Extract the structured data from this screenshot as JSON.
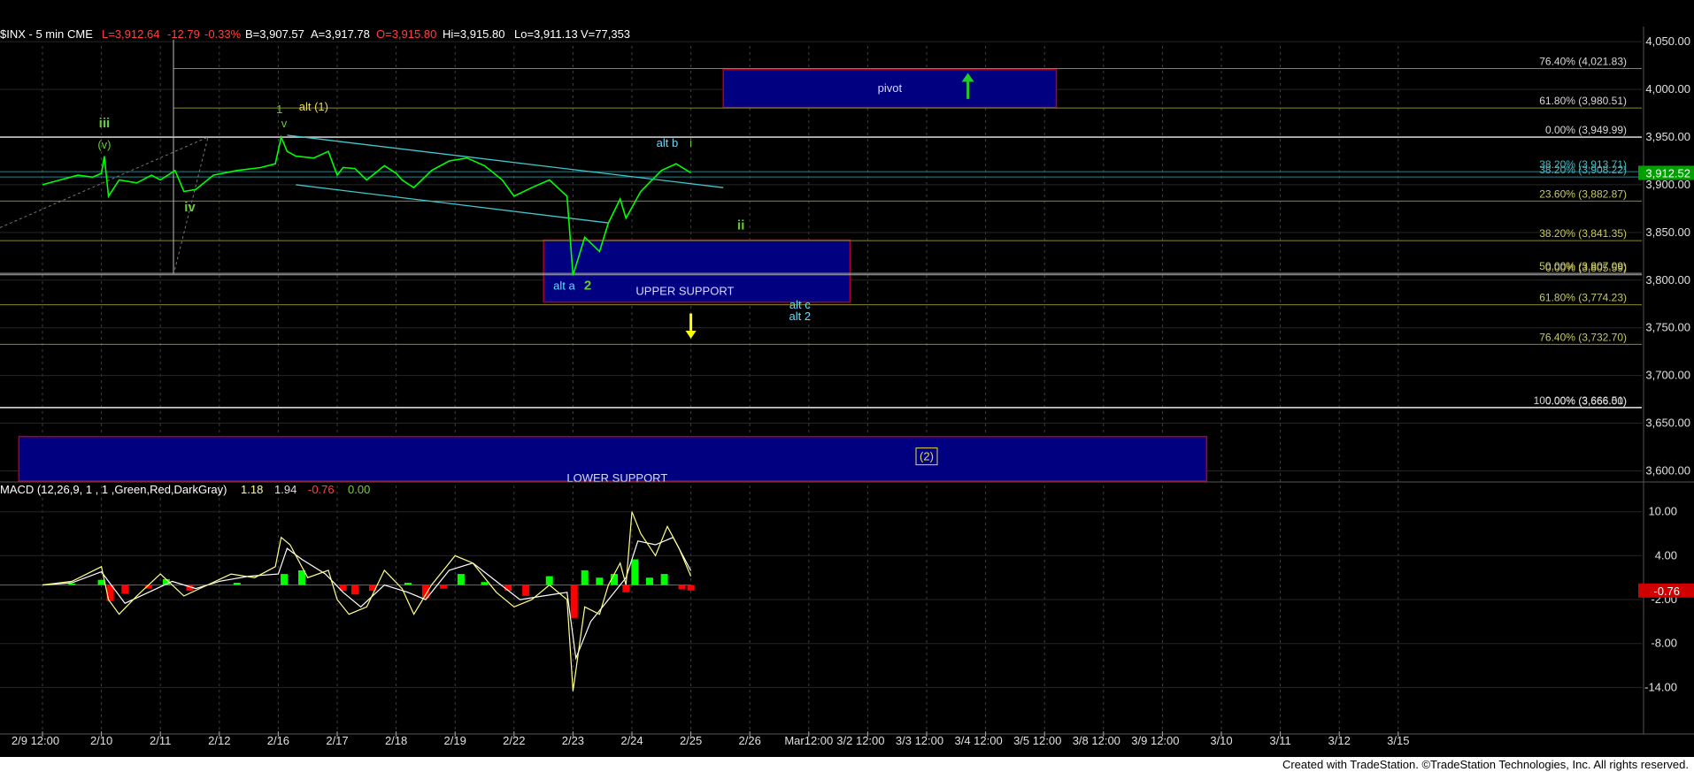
{
  "header": {
    "symbol": "$INX - 5 min",
    "exchange": "CME",
    "last": "L=3,912.64",
    "change": "-12.79",
    "change_pct": "-0.33%",
    "bid": "B=3,907.57",
    "ask": "A=3,917.78",
    "open": "O=3,915.80",
    "high": "Hi=3,915.80",
    "low": "Lo=3,911.13",
    "volume": "V=77,353"
  },
  "footer": {
    "credit": "Created with TradeStation. ©TradeStation Technologies, Inc. All rights reserved."
  },
  "colors": {
    "background": "#000000",
    "price_line": "#00ff00",
    "support_zone": "#000080",
    "zone_border": "#b00020",
    "channel": "#40c8d0",
    "fib_level": "#8a8a2a",
    "wave_green": "#66cc33",
    "wave_yellow": "#e8d85a",
    "wave_cyan": "#66d9ff",
    "arrow_green": "#22cc22",
    "arrow_yellow": "#ffff00",
    "macd_line": "#ffff88",
    "signal_line": "#ffffff",
    "hist_up": "#00ff00",
    "hist_down": "#ff0000"
  },
  "chart_data": [
    {
      "type": "line",
      "name": "price",
      "x_ticks": [
        "2/9 12:00",
        "2/10",
        "2/11",
        "2/12",
        "2/16",
        "2/17",
        "2/18",
        "2/19",
        "2/22",
        "2/23",
        "2/24",
        "2/25",
        "2/26",
        "Mar12:00",
        "3/2 12:00",
        "3/3 12:00",
        "3/4 12:00",
        "3/5 12:00",
        "3/8 12:00",
        "3/9 12:00",
        "3/10",
        "3/11",
        "3/12",
        "3/15"
      ],
      "y_ticks": [
        "4,050.00",
        "4,000.00",
        "3,950.00",
        "3,900.00",
        "3,850.00",
        "3,800.00",
        "3,750.00",
        "3,700.00",
        "3,650.00",
        "3,600.00"
      ],
      "ylim": [
        3585,
        4052
      ],
      "last_price_label": "3,912.52",
      "last_price": 3912.52,
      "series_points": [
        [
          0,
          3900
        ],
        [
          0.3,
          3905
        ],
        [
          0.6,
          3910
        ],
        [
          0.85,
          3908
        ],
        [
          1.0,
          3912
        ],
        [
          1.05,
          3930
        ],
        [
          1.12,
          3888
        ],
        [
          1.3,
          3905
        ],
        [
          1.6,
          3902
        ],
        [
          1.85,
          3910
        ],
        [
          2.0,
          3905
        ],
        [
          2.25,
          3915
        ],
        [
          2.4,
          3893
        ],
        [
          2.6,
          3895
        ],
        [
          2.9,
          3910
        ],
        [
          3.3,
          3915
        ],
        [
          3.7,
          3918
        ],
        [
          3.95,
          3922
        ],
        [
          4.05,
          3950
        ],
        [
          4.15,
          3935
        ],
        [
          4.3,
          3930
        ],
        [
          4.6,
          3928
        ],
        [
          4.85,
          3935
        ],
        [
          5.0,
          3910
        ],
        [
          5.1,
          3918
        ],
        [
          5.3,
          3917
        ],
        [
          5.5,
          3905
        ],
        [
          5.8,
          3920
        ],
        [
          6.0,
          3912
        ],
        [
          6.1,
          3905
        ],
        [
          6.3,
          3897
        ],
        [
          6.6,
          3915
        ],
        [
          6.9,
          3925
        ],
        [
          7.2,
          3928
        ],
        [
          7.5,
          3920
        ],
        [
          7.8,
          3905
        ],
        [
          8.0,
          3888
        ],
        [
          8.3,
          3897
        ],
        [
          8.6,
          3905
        ],
        [
          8.9,
          3888
        ],
        [
          9.0,
          3805
        ],
        [
          9.2,
          3845
        ],
        [
          9.45,
          3830
        ],
        [
          9.6,
          3860
        ],
        [
          9.8,
          3885
        ],
        [
          9.9,
          3865
        ],
        [
          10.15,
          3893
        ],
        [
          10.5,
          3915
        ],
        [
          10.75,
          3922
        ],
        [
          11.0,
          3912.5
        ]
      ],
      "fib_levels": [
        {
          "label": "76.40% (4,021.83)",
          "value": 4021.83
        },
        {
          "label": "61.80% (3,980.51)",
          "value": 3980.51
        },
        {
          "label": "0.00% (3,949.99)",
          "value": 3949.99
        },
        {
          "label": "38.20% (3,913.71)",
          "value": 3913.71
        },
        {
          "label": "38.20% (3,908.22)",
          "value": 3908.22
        },
        {
          "label": "23.60% (3,882.87)",
          "value": 3882.87
        },
        {
          "label": "38.20% (3,841.35)",
          "value": 3841.35
        },
        {
          "label": "50.00% (3,807.09)",
          "value": 3807.09
        },
        {
          "label": "0.00% (3,805.59)",
          "value": 3805.59
        },
        {
          "label": "61.80% (3,774.23)",
          "value": 3774.23
        },
        {
          "label": "76.40% (3,732.70)",
          "value": 3732.7
        },
        {
          "label": "100.00% (3,666.51)",
          "value": 3666.51
        },
        {
          "label": "0.00% (3,666.00)",
          "value": 3666.0
        }
      ],
      "zones": [
        {
          "name": "pivot",
          "label": "pivot",
          "x_from": 11.55,
          "x_to": 17.2,
          "y_from": 3981,
          "y_to": 4021
        },
        {
          "name": "upper-support",
          "label": "UPPER SUPPORT",
          "x_from": 8.5,
          "x_to": 13.7,
          "y_from": 3777,
          "y_to": 3842
        },
        {
          "name": "lower-support",
          "label": "LOWER SUPPORT",
          "x_from": -0.4,
          "x_to": 19.75,
          "y_from": 3585,
          "y_to": 3636
        }
      ],
      "wave_labels": [
        {
          "text": "iii",
          "x": 1.05,
          "y": 3960,
          "color": "green"
        },
        {
          "text": "(v)",
          "x": 1.05,
          "y": 3938,
          "color": "green"
        },
        {
          "text": "iv",
          "x": 2.5,
          "y": 3872,
          "color": "green"
        },
        {
          "text": "1",
          "x": 4.02,
          "y": 3975,
          "color": "green"
        },
        {
          "text": "v",
          "x": 4.1,
          "y": 3960,
          "color": "green"
        },
        {
          "text": "alt (1)",
          "x": 4.6,
          "y": 3978,
          "color": "yellow"
        },
        {
          "text": "alt b",
          "x": 10.6,
          "y": 3940,
          "color": "cyan"
        },
        {
          "text": "i",
          "x": 11.0,
          "y": 3940,
          "color": "green"
        },
        {
          "text": "ii",
          "x": 11.85,
          "y": 3853,
          "color": "green"
        },
        {
          "text": "alt a",
          "x": 8.85,
          "y": 3790,
          "color": "cyan"
        },
        {
          "text": "2",
          "x": 9.25,
          "y": 3790,
          "color": "green"
        },
        {
          "text": "alt c",
          "x": 12.85,
          "y": 3770,
          "color": "cyan"
        },
        {
          "text": "alt 2",
          "x": 12.85,
          "y": 3758,
          "color": "cyan"
        },
        {
          "text": "(2)",
          "x": 15.0,
          "y": 3611,
          "color": "yellow"
        }
      ]
    },
    {
      "type": "line",
      "name": "MACD",
      "indicator_label": "MACD (12,26,9, 1 , 1 ,Green,Red,DarkGray)",
      "values_shown": [
        "1.18",
        "1.94",
        "-0.76",
        "0.00"
      ],
      "last_value": -0.76,
      "last_value_label": "-0.76",
      "y_ticks": [
        "10.00",
        "4.00",
        "-2.00",
        "-8.00",
        "-14.00"
      ],
      "ylim": [
        -15.5,
        12.5
      ],
      "macd_points": [
        [
          0,
          0
        ],
        [
          0.5,
          0.5
        ],
        [
          1.0,
          2.5
        ],
        [
          1.12,
          -2
        ],
        [
          1.3,
          -4
        ],
        [
          1.6,
          -1.5
        ],
        [
          2.0,
          1.5
        ],
        [
          2.4,
          -1.5
        ],
        [
          2.8,
          0
        ],
        [
          3.2,
          1.5
        ],
        [
          3.6,
          1
        ],
        [
          3.95,
          2.5
        ],
        [
          4.05,
          6.5
        ],
        [
          4.2,
          5.5
        ],
        [
          4.5,
          1
        ],
        [
          4.85,
          2
        ],
        [
          5.0,
          -2
        ],
        [
          5.2,
          -4
        ],
        [
          5.5,
          -3
        ],
        [
          5.8,
          2
        ],
        [
          6.1,
          -0.5
        ],
        [
          6.3,
          -4
        ],
        [
          6.6,
          0
        ],
        [
          7.0,
          4
        ],
        [
          7.3,
          3
        ],
        [
          7.7,
          -1
        ],
        [
          8.0,
          -3
        ],
        [
          8.3,
          -2
        ],
        [
          8.6,
          0
        ],
        [
          8.9,
          -2
        ],
        [
          9.0,
          -14.5
        ],
        [
          9.2,
          -3
        ],
        [
          9.45,
          -4
        ],
        [
          9.6,
          0
        ],
        [
          9.8,
          3
        ],
        [
          9.9,
          0
        ],
        [
          10.0,
          10
        ],
        [
          10.15,
          7
        ],
        [
          10.4,
          4
        ],
        [
          10.6,
          8
        ],
        [
          10.8,
          5
        ],
        [
          11.0,
          1.18
        ]
      ],
      "signal_points": [
        [
          0,
          0
        ],
        [
          0.5,
          0.3
        ],
        [
          1.0,
          1.8
        ],
        [
          1.12,
          0.5
        ],
        [
          1.4,
          -2.5
        ],
        [
          1.8,
          -1
        ],
        [
          2.2,
          0.5
        ],
        [
          2.6,
          -0.5
        ],
        [
          3.0,
          0.5
        ],
        [
          3.5,
          1.2
        ],
        [
          4.0,
          1.5
        ],
        [
          4.15,
          5
        ],
        [
          4.4,
          3.5
        ],
        [
          4.8,
          1.5
        ],
        [
          5.1,
          -1
        ],
        [
          5.4,
          -3
        ],
        [
          5.8,
          0
        ],
        [
          6.2,
          -1
        ],
        [
          6.5,
          -2
        ],
        [
          6.9,
          2
        ],
        [
          7.3,
          3
        ],
        [
          7.7,
          0.5
        ],
        [
          8.1,
          -2
        ],
        [
          8.5,
          -1.5
        ],
        [
          8.9,
          -1
        ],
        [
          9.05,
          -10
        ],
        [
          9.3,
          -5
        ],
        [
          9.6,
          -2
        ],
        [
          9.9,
          1
        ],
        [
          10.1,
          6
        ],
        [
          10.4,
          5.5
        ],
        [
          10.7,
          6.5
        ],
        [
          11.0,
          1.94
        ]
      ],
      "histogram_points": [
        [
          0.5,
          0.2
        ],
        [
          1.0,
          0.7
        ],
        [
          1.15,
          -2.2
        ],
        [
          1.4,
          -1.2
        ],
        [
          1.8,
          -0.5
        ],
        [
          2.1,
          0.8
        ],
        [
          2.5,
          -0.8
        ],
        [
          3.3,
          0.3
        ],
        [
          4.1,
          1.5
        ],
        [
          4.4,
          2
        ],
        [
          5.1,
          -0.8
        ],
        [
          5.3,
          -1.3
        ],
        [
          5.6,
          -0.8
        ],
        [
          6.2,
          0.3
        ],
        [
          6.5,
          -1.8
        ],
        [
          6.8,
          -0.5
        ],
        [
          7.1,
          1.5
        ],
        [
          7.5,
          0.4
        ],
        [
          7.9,
          -0.8
        ],
        [
          8.2,
          -1.5
        ],
        [
          8.6,
          1.2
        ],
        [
          9.02,
          -4.5
        ],
        [
          9.2,
          2
        ],
        [
          9.45,
          1
        ],
        [
          9.7,
          1.5
        ],
        [
          9.9,
          -1
        ],
        [
          10.05,
          3.5
        ],
        [
          10.3,
          1
        ],
        [
          10.55,
          1.5
        ],
        [
          10.85,
          -0.6
        ],
        [
          11.0,
          -0.76
        ]
      ]
    }
  ]
}
